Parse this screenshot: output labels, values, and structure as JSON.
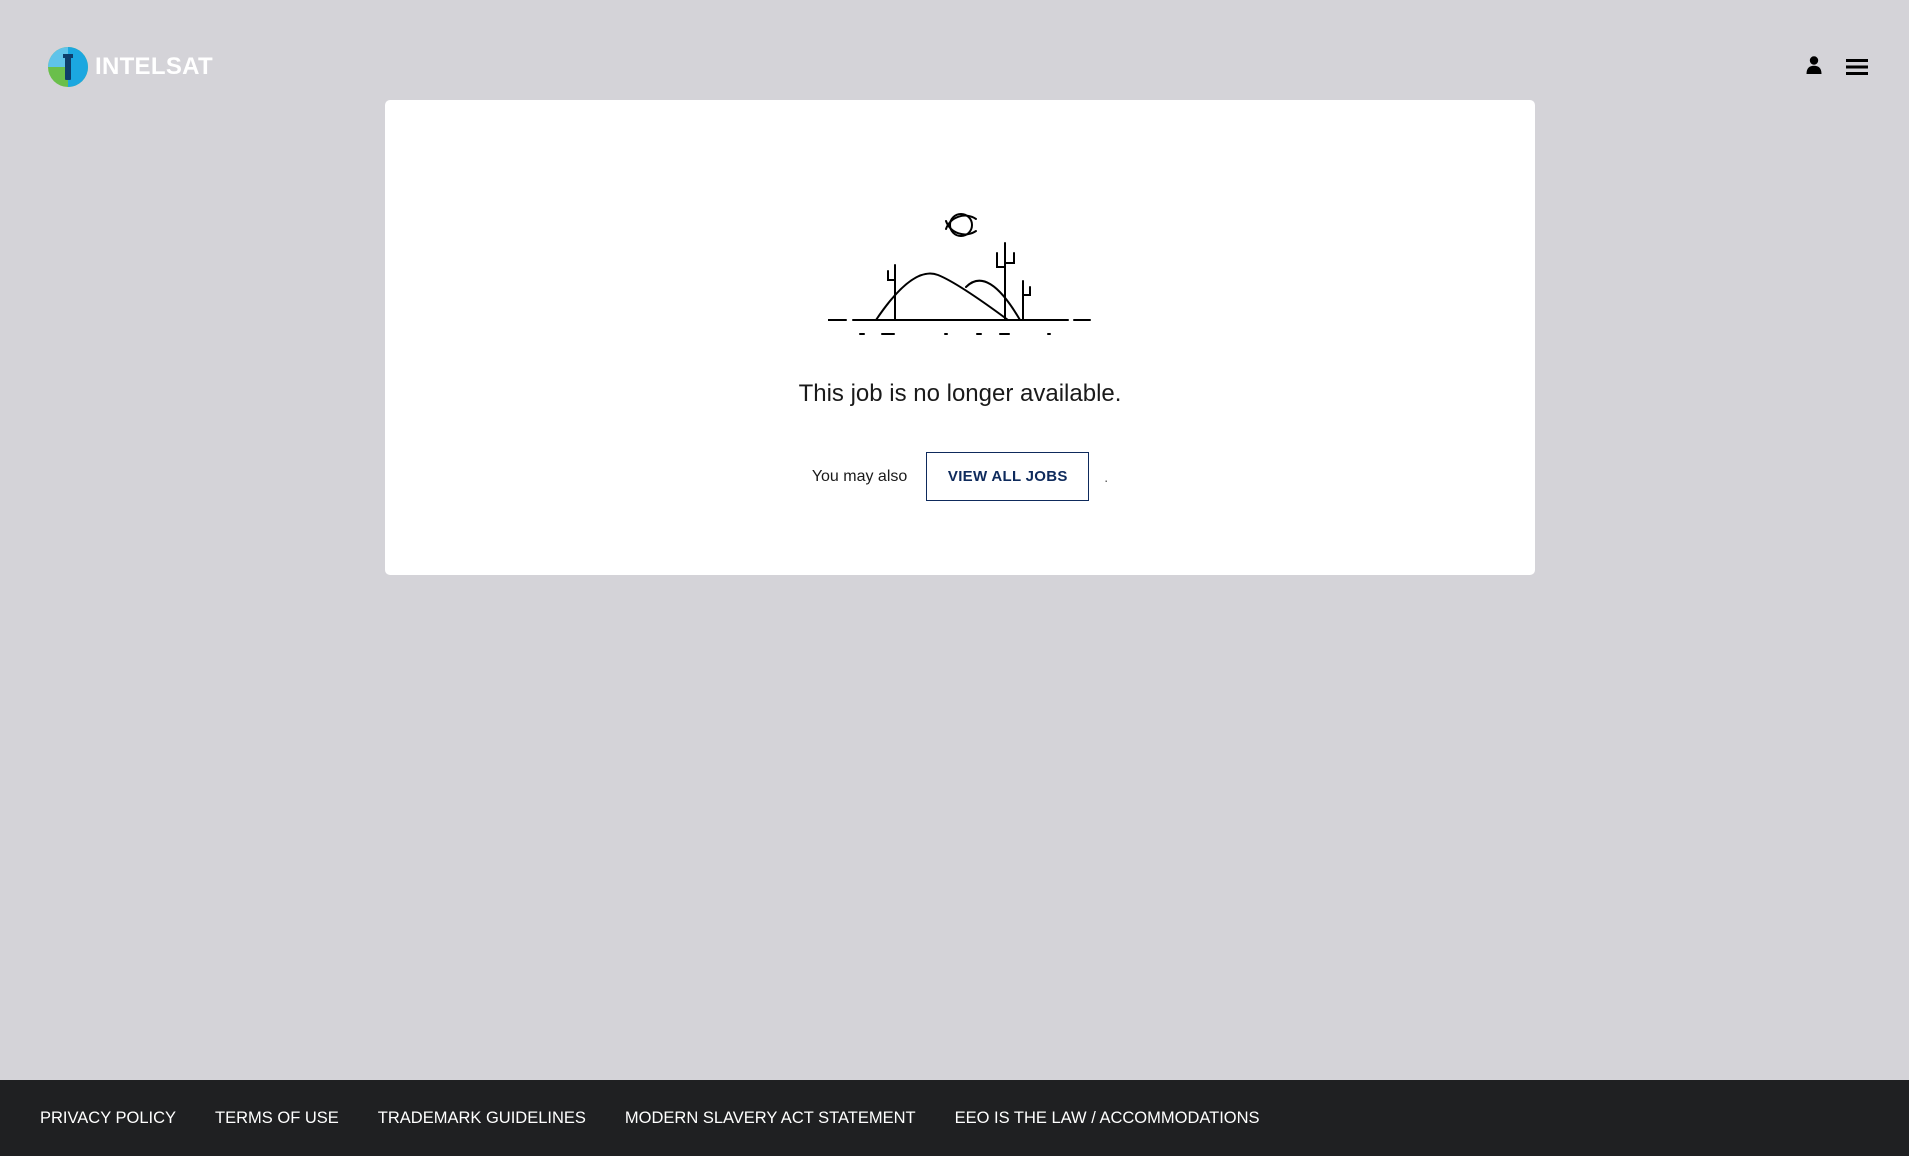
{
  "header": {
    "logo_text": "INTELSAT",
    "user_icon": "user-icon",
    "menu_icon": "hamburger-menu-icon"
  },
  "main": {
    "illustration_icon": "empty-desert-landscape-icon",
    "message": "This job is no longer available.",
    "cta_prefix": "You may also",
    "cta_button_label": "VIEW ALL JOBS",
    "cta_suffix": "."
  },
  "footer": {
    "links": [
      {
        "label": "PRIVACY POLICY"
      },
      {
        "label": "TERMS OF USE"
      },
      {
        "label": "TRADEMARK GUIDELINES"
      },
      {
        "label": "MODERN SLAVERY ACT STATEMENT"
      },
      {
        "label": "EEO IS THE LAW / ACCOMMODATIONS"
      }
    ]
  },
  "colors": {
    "page_background": "#d4d3d8",
    "card_background": "#ffffff",
    "footer_background": "#1f2022",
    "button_accent": "#0e2a5c",
    "logo_blue": "#1ba7e0",
    "logo_green": "#6abf4b"
  }
}
